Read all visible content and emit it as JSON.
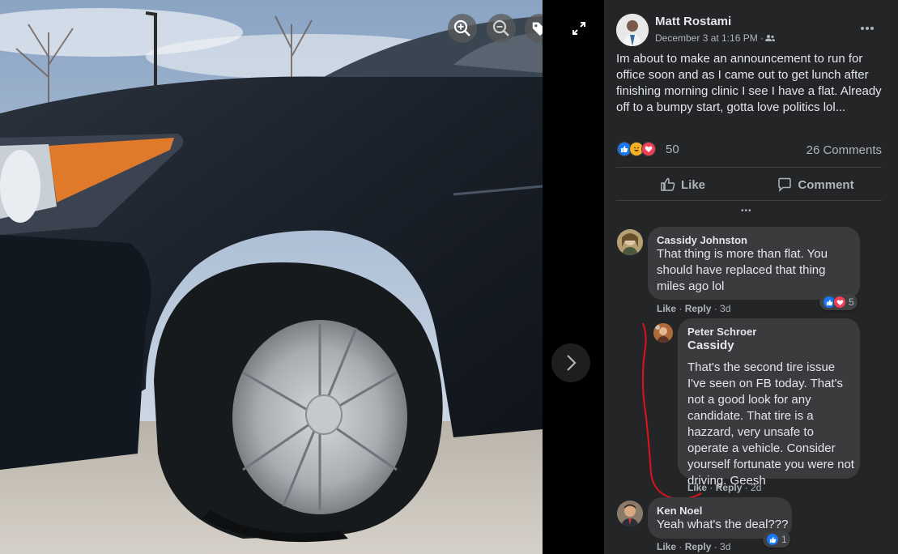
{
  "photo_toolbar": {
    "zoom_in_icon": "zoom-in-icon",
    "zoom_out_icon": "zoom-out-icon",
    "tag_icon": "tag-icon",
    "fullscreen_icon": "fullscreen-icon",
    "next_icon": "chevron-right-icon"
  },
  "post": {
    "author": "Matt Rostami",
    "date": "December 3 at 1:16 PM · ",
    "audience_icon": "friends-icon",
    "more_icon": "more-horizontal-icon",
    "text": "Im about to make an announcement to run for office soon and as I came out to get lunch after finishing morning clinic I see I have a flat. Already off to a bumpy start, gotta love politics lol...",
    "reaction_count": "50",
    "comments_count": "26 Comments",
    "like_label": "Like",
    "comment_label": "Comment",
    "more_comments": "•••"
  },
  "comments": [
    {
      "author": "Cassidy Johnston",
      "text": "That thing is more than flat. You should have replaced that thing miles ago lol",
      "like": "Like",
      "reply": "Reply",
      "time": "3d",
      "reactions": "5"
    },
    {
      "author": "Peter Schroer",
      "mention": "Cassidy",
      "text": "That's the second tire issue I've seen on FB today. That's not a good look for any candidate. That tire is a hazzard, very unsafe to operate a vehicle. Consider yourself fortunate you were not driving. Geesh",
      "like": "Like",
      "reply": "Reply",
      "time": "2d"
    },
    {
      "author": "Ken Noel",
      "text": "Yeah what's the deal???",
      "like": "Like",
      "reply": "Reply",
      "time": "3d",
      "reactions": "1"
    }
  ],
  "colors": {
    "panel_bg": "#242526",
    "bubble_bg": "#3a3b3c",
    "like_blue": "#1877f2",
    "love_red": "#f33e58",
    "haha_yellow": "#f7b125",
    "annotation_red": "#e0121b"
  }
}
